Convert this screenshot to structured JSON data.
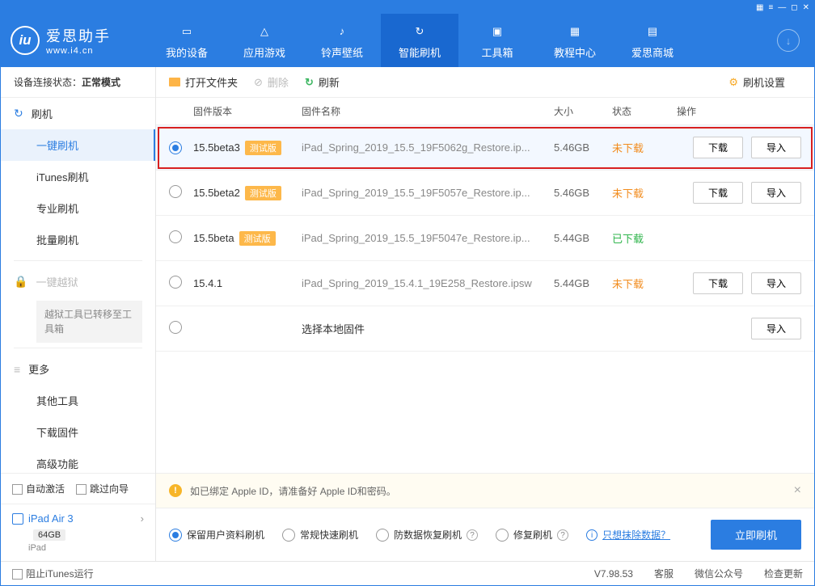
{
  "app": {
    "title": "爱思助手",
    "url": "www.i4.cn"
  },
  "nav": {
    "items": [
      "我的设备",
      "应用游戏",
      "铃声壁纸",
      "智能刷机",
      "工具箱",
      "教程中心",
      "爱思商城"
    ],
    "active_index": 3
  },
  "sidebar": {
    "device_status_label": "设备连接状态：",
    "device_status_value": "正常模式",
    "flash_header": "刷机",
    "flash_subs": [
      "一键刷机",
      "iTunes刷机",
      "专业刷机",
      "批量刷机"
    ],
    "jailbreak_header": "一键越狱",
    "jailbreak_note": "越狱工具已转移至工具箱",
    "more_header": "更多",
    "more_subs": [
      "其他工具",
      "下载固件",
      "高级功能"
    ],
    "auto_activate": "自动激活",
    "skip_guide": "跳过向导",
    "device_name": "iPad Air 3",
    "device_storage": "64GB",
    "device_type": "iPad"
  },
  "toolbar": {
    "open_folder": "打开文件夹",
    "delete": "删除",
    "refresh": "刷新",
    "settings": "刷机设置"
  },
  "columns": {
    "version": "固件版本",
    "name": "固件名称",
    "size": "大小",
    "status": "状态",
    "ops": "操作"
  },
  "tags": {
    "test": "测试版"
  },
  "btn_labels": {
    "download": "下载",
    "import": "导入"
  },
  "rows": [
    {
      "selected": true,
      "version": "15.5beta3",
      "test": true,
      "name": "iPad_Spring_2019_15.5_19F5062g_Restore.ip...",
      "size": "5.46GB",
      "status_key": "未下载",
      "status_class": "st-orange",
      "download": true,
      "import": true
    },
    {
      "selected": false,
      "version": "15.5beta2",
      "test": true,
      "name": "iPad_Spring_2019_15.5_19F5057e_Restore.ip...",
      "size": "5.46GB",
      "status_key": "未下载",
      "status_class": "st-orange",
      "download": true,
      "import": true
    },
    {
      "selected": false,
      "version": "15.5beta",
      "test": true,
      "name": "iPad_Spring_2019_15.5_19F5047e_Restore.ip...",
      "size": "5.44GB",
      "status_key": "已下载",
      "status_class": "st-green",
      "download": false,
      "import": false
    },
    {
      "selected": false,
      "version": "15.4.1",
      "test": false,
      "name": "iPad_Spring_2019_15.4.1_19E258_Restore.ipsw",
      "size": "5.44GB",
      "status_key": "未下载",
      "status_class": "st-orange",
      "download": true,
      "import": true
    },
    {
      "selected": false,
      "version": "",
      "test": false,
      "name": "选择本地固件",
      "name_color": "#333",
      "size": "",
      "status_key": "",
      "status_class": "",
      "download": false,
      "import": true,
      "no_border": false
    }
  ],
  "notice": {
    "text": "如已绑定 Apple ID，请准备好 Apple ID和密码。"
  },
  "options": {
    "keep_data": "保留用户资料刷机",
    "regular": "常规快速刷机",
    "anti_data_recovery": "防数据恢复刷机",
    "repair": "修复刷机",
    "erase_link": "只想抹除数据？",
    "flash_now": "立即刷机"
  },
  "footer": {
    "block_itunes": "阻止iTunes运行",
    "version": "V7.98.53",
    "kefu": "客服",
    "weixin": "微信公众号",
    "update": "检查更新"
  }
}
